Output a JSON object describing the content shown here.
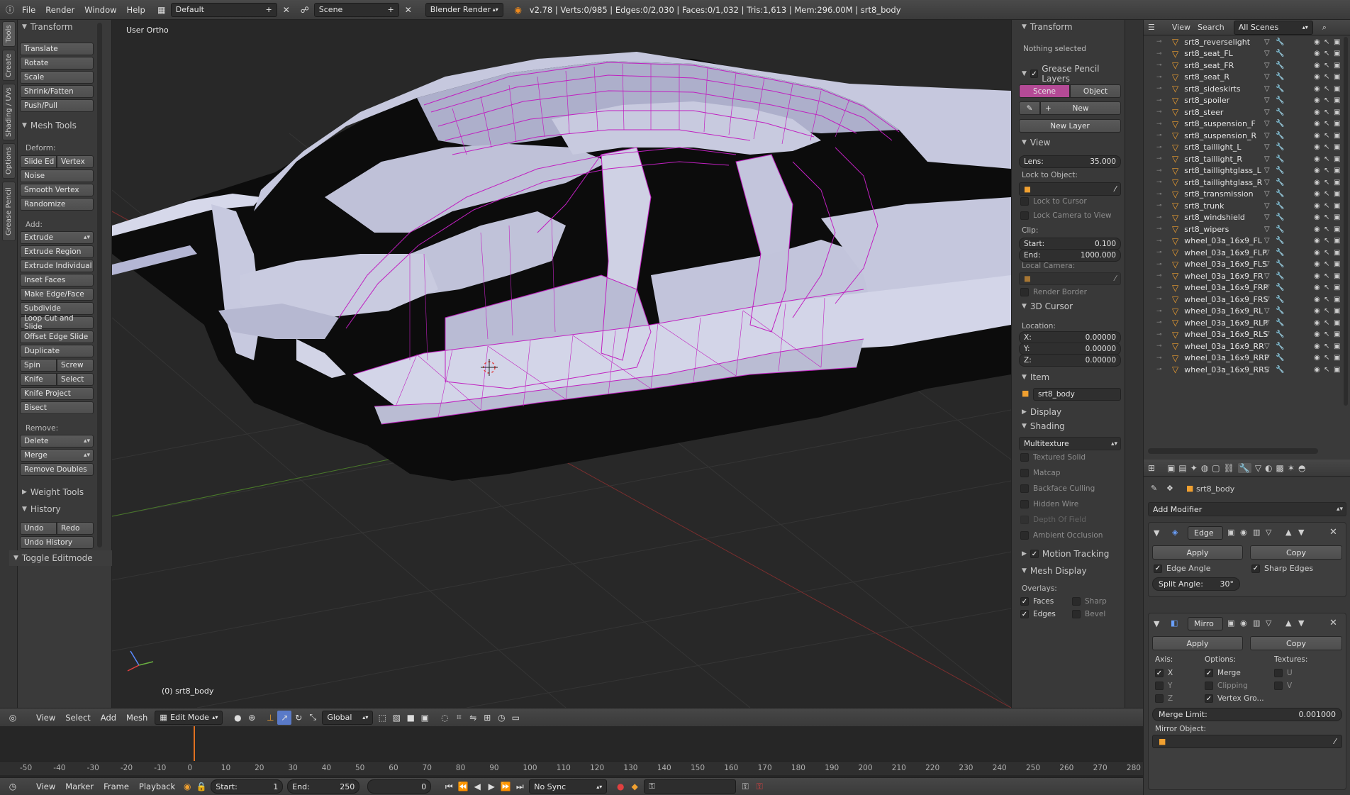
{
  "topbar": {
    "menus": [
      "File",
      "Render",
      "Window",
      "Help"
    ],
    "layout": "Default",
    "scene": "Scene",
    "engine": "Blender Render",
    "stats": "v2.78 | Verts:0/985 | Edges:0/2,030 | Faces:0/1,032 | Tris:1,613 | Mem:296.00M | srt8_body"
  },
  "tool_tabs": [
    "Tools",
    "Create",
    "Shading / UVs",
    "Options",
    "Grease Pencil"
  ],
  "toolshelf": {
    "transform_head": "Transform",
    "transform": [
      "Translate",
      "Rotate",
      "Scale",
      "Shrink/Fatten",
      "Push/Pull"
    ],
    "mesh_tools_head": "Mesh Tools",
    "deform_label": "Deform:",
    "slide_edge": "Slide Ed",
    "vertex": "Vertex",
    "deform": [
      "Noise",
      "Smooth Vertex",
      "Randomize"
    ],
    "add_label": "Add:",
    "extrude": "Extrude",
    "add": [
      "Extrude Region",
      "Extrude Individual",
      "Inset Faces",
      "Make Edge/Face",
      "Subdivide",
      "Loop Cut and Slide",
      "Offset Edge Slide",
      "Duplicate"
    ],
    "spin": "Spin",
    "screw": "Screw",
    "knife": "Knife",
    "select": "Select",
    "knife_project": "Knife Project",
    "bisect": "Bisect",
    "remove_label": "Remove:",
    "delete": "Delete",
    "merge": "Merge",
    "remove_doubles": "Remove Doubles",
    "weight_tools": "Weight Tools",
    "history": "History",
    "undo": "Undo",
    "redo": "Redo",
    "undo_history": "Undo History",
    "toggle_editmode": "Toggle Editmode"
  },
  "viewport": {
    "view_label": "User Ortho",
    "object_label": "(0) srt8_body",
    "wire_color": "#c020c0",
    "body_color": "#c4c6dc"
  },
  "npanel": {
    "transform_head": "Transform",
    "nothing_selected": "Nothing selected",
    "grease_layers": "Grease Pencil Layers",
    "scene_tab": "Scene",
    "object_tab": "Object",
    "new_btn": "New",
    "new_layer_btn": "New Layer",
    "view_head": "View",
    "lens_label": "Lens:",
    "lens_value": "35.000",
    "lock_to_object": "Lock to Object:",
    "lock_to_cursor": "Lock to Cursor",
    "lock_camera": "Lock Camera to View",
    "clip_label": "Clip:",
    "start_label": "Start:",
    "start_value": "0.100",
    "end_label": "End:",
    "end_value": "1000.000",
    "local_camera": "Local Camera:",
    "render_border": "Render Border",
    "cursor_head": "3D Cursor",
    "location_label": "Location:",
    "x_label": "X:",
    "x_value": "0.00000",
    "y_label": "Y:",
    "y_value": "0.00000",
    "z_label": "Z:",
    "z_value": "0.00000",
    "item_head": "Item",
    "item_name": "srt8_body",
    "display_head": "Display",
    "shading_head": "Shading",
    "shading_mode": "Multitexture",
    "shading_opts": [
      "Textured Solid",
      "Matcap",
      "Backface Culling",
      "Hidden Wire",
      "Depth Of Field",
      "Ambient Occlusion"
    ],
    "motion_tracking": "Motion Tracking",
    "mesh_display_head": "Mesh Display",
    "overlays_label": "Overlays:",
    "faces": "Faces",
    "sharp": "Sharp",
    "edges": "Edges",
    "bevel": "Bevel"
  },
  "outliner": {
    "view_menu": "View",
    "search_menu": "Search",
    "scope": "All Scenes",
    "items": [
      "srt8_reverselight",
      "srt8_seat_FL",
      "srt8_seat_FR",
      "srt8_seat_R",
      "srt8_sideskirts",
      "srt8_spoiler",
      "srt8_steer",
      "srt8_suspension_F",
      "srt8_suspension_R",
      "srt8_taillight_L",
      "srt8_taillight_R",
      "srt8_taillightglass_L",
      "srt8_taillightglass_R",
      "srt8_transmission",
      "srt8_trunk",
      "srt8_windshield",
      "srt8_wipers",
      "wheel_03a_16x9_FL",
      "wheel_03a_16x9_FLP",
      "wheel_03a_16x9_FLS",
      "wheel_03a_16x9_FR",
      "wheel_03a_16x9_FRP",
      "wheel_03a_16x9_FRS",
      "wheel_03a_16x9_RL",
      "wheel_03a_16x9_RLP",
      "wheel_03a_16x9_RLS",
      "wheel_03a_16x9_RR",
      "wheel_03a_16x9_RRP",
      "wheel_03a_16x9_RRS"
    ]
  },
  "properties": {
    "object_name": "srt8_body",
    "add_modifier": "Add Modifier",
    "mod1_name": "Edge",
    "apply": "Apply",
    "copy": "Copy",
    "edge_angle": "Edge Angle",
    "sharp_edges": "Sharp Edges",
    "split_angle_label": "Split Angle:",
    "split_angle_value": "30°",
    "mod2_name": "Mirro",
    "axis_label": "Axis:",
    "options_label": "Options:",
    "textures_label": "Textures:",
    "ax_x": "X",
    "ax_y": "Y",
    "ax_z": "Z",
    "merge": "Merge",
    "clipping": "Clipping",
    "vertex_groups": "Vertex Gro...",
    "tex_u": "U",
    "tex_v": "V",
    "merge_limit_label": "Merge Limit:",
    "merge_limit_value": "0.001000",
    "mirror_object": "Mirror Object:"
  },
  "vpheader": {
    "menus": [
      "View",
      "Select",
      "Add",
      "Mesh"
    ],
    "mode": "Edit Mode",
    "orientation": "Global"
  },
  "timeline": {
    "ticks": [
      "-50",
      "-40",
      "-30",
      "-20",
      "-10",
      "0",
      "10",
      "20",
      "30",
      "40",
      "50",
      "60",
      "70",
      "80",
      "90",
      "100",
      "110",
      "120",
      "130",
      "140",
      "150",
      "160",
      "170",
      "180",
      "190",
      "200",
      "210",
      "220",
      "230",
      "240",
      "250",
      "260",
      "270",
      "280"
    ],
    "current_frame_marker": 0,
    "menus": [
      "View",
      "Marker",
      "Frame",
      "Playback"
    ],
    "start_label": "Start:",
    "start_value": "1",
    "end_label": "End:",
    "end_value": "250",
    "current_value": "0",
    "sync": "No Sync"
  }
}
